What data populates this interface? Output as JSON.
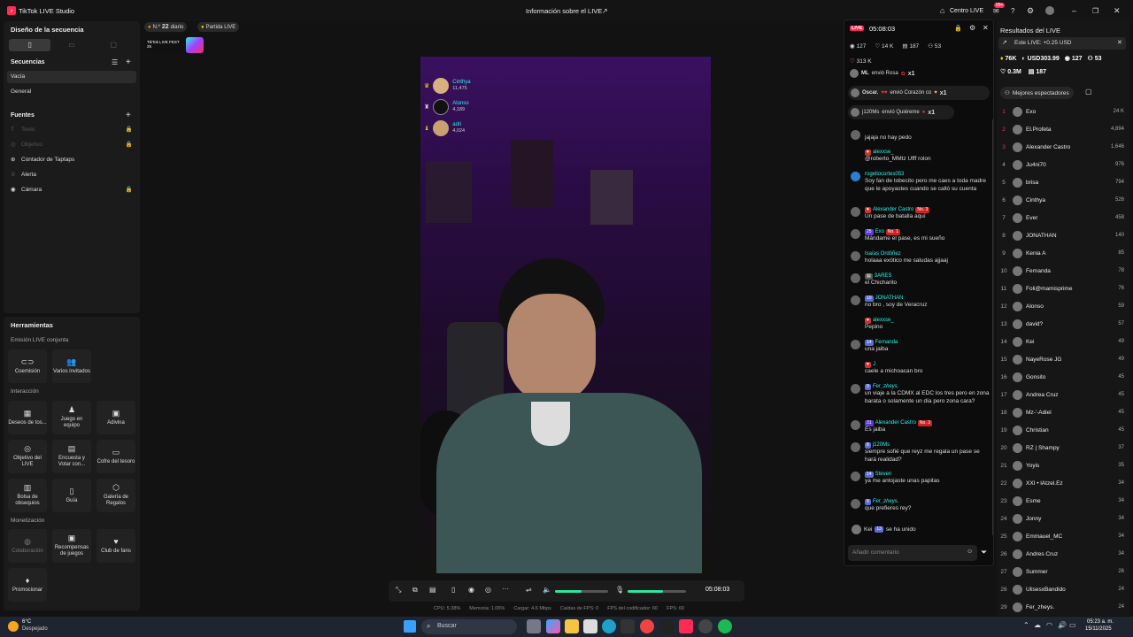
{
  "titlebar": {
    "app_title": "TikTok LIVE Studio",
    "center_title": "Información sobre el LIVE",
    "live_center": "Centro LIVE",
    "notif_badge": "99+"
  },
  "left": {
    "scene_design": "Diseño de la secuencia",
    "sequences": "Secuencias",
    "seq_items": [
      "Vacía",
      "General"
    ],
    "sources": "Fuentes",
    "source_items": [
      "Texto",
      "Objetivo",
      "Contador de Taptaps",
      "Alerta",
      "Cámara"
    ],
    "tools": "Herramientas",
    "joint": "Emisión LIVE conjunta",
    "t_coem": "Coemisión",
    "t_varios": "Varios invitados",
    "interaction": "Interacción",
    "t_deseos": "Deseos de tos...",
    "t_juego": "Juego en equipo",
    "t_adivina": "Adivina",
    "t_objetivo": "Objetivo del LIVE",
    "t_encuesta": "Encuesta y Votar con...",
    "t_cofre": "Cofre del tesoro",
    "t_bolsa": "Bolsa de obsequios",
    "t_guia": "Guía",
    "t_galeria": "Galería de Regalos",
    "monet": "Monetización",
    "t_colab": "Colaboración",
    "t_recomp": "Recompensas de juegos",
    "t_club": "Club de fans",
    "t_promo": "Promocionar"
  },
  "preview": {
    "rank_no": "N.º",
    "rank_val": "22",
    "rank_label": "diario",
    "match": "Partida LIVE",
    "fest": "TikTok LIVE FEST 25",
    "top": [
      {
        "name": "Cinthya",
        "score": "11,475"
      },
      {
        "name": "Alonso",
        "score": "4,189"
      },
      {
        "name": "adri",
        "score": "4,024"
      }
    ]
  },
  "controls": {
    "timer": "05:08:03",
    "mic_level": 0.6,
    "vol_level": 0.5
  },
  "stats": {
    "cpu": "CPU: 5.38%",
    "mem": "Memoria: 1.06%",
    "load": "Cargar: 4.6 Mbps",
    "fps_drop": "Caídas de FPS: 0",
    "enc_fps": "FPS del codificador: 60",
    "fps": "FPS: 60"
  },
  "chat": {
    "live": "LIVE",
    "timer": "05:08:03",
    "viewers": "127",
    "likes": "14 K",
    "shares": "187",
    "users": "53",
    "diamonds": "313 K",
    "gifts": [
      {
        "user": "ML",
        "text": "envió Rosa",
        "count": "x1"
      },
      {
        "user": "Oscar.",
        "text": "envió Corazón co",
        "count": "x1"
      },
      {
        "user": "j120Ms",
        "text": "envió Quiéreme",
        "count": "x1"
      }
    ],
    "messages": [
      {
        "user": "",
        "badge": "",
        "text": "jajaja no hay pedo"
      },
      {
        "user": "alexxse_",
        "badge": "",
        "text": "@roberto_MMtz Ufff rolon"
      },
      {
        "user": "rogeliocortes053",
        "badge": "",
        "text": "Soy fan de tobecito pero me caes a toda madre que le apoyastes cuando se calló su cuenta"
      },
      {
        "user": "Alexander Castro",
        "badge": "No. 3",
        "text": "Un pase de batalla aquí"
      },
      {
        "user": "Exo",
        "badge": "No. 1",
        "text": "Mándame el pase, es mi sueño"
      },
      {
        "user": "Isaías Ordóñez",
        "badge": "",
        "text": "holaaa exótico me saludas ajjaaj"
      },
      {
        "user": "3ARES",
        "badge": "",
        "text": "el Chicharito"
      },
      {
        "user": "JONATHAN",
        "badge": "",
        "text": "no bro , soy de Veracruz"
      },
      {
        "user": "alexxse_",
        "badge": "",
        "text": "Pepino"
      },
      {
        "user": "Fernanda",
        "badge": "",
        "text": "una jaiba"
      },
      {
        "user": "J",
        "badge": "",
        "text": "caele a michoacan bro"
      },
      {
        "user": "Fer_zheys.",
        "badge": "",
        "text": "un viaje a la CDMX al EDC los tres pero en zona barata o solamente un día pero zona cara?"
      },
      {
        "user": "Alexander Castro",
        "badge": "No. 3",
        "text": "Es jaiba"
      },
      {
        "user": "j120Ms",
        "badge": "",
        "text": "siempre sofié que reyz me regala un pase se hará realidad?"
      },
      {
        "user": "Steven",
        "badge": "",
        "text": "ya me antojaste unas papitas"
      },
      {
        "user": "Fer_zheys.",
        "badge": "",
        "text": "que prefieres rey?"
      }
    ],
    "joined_user": "Kei",
    "joined_text": "se ha unido",
    "comment_placeholder": "Añadir comentario"
  },
  "results": {
    "title": "Resultados del LIVE",
    "this_live": "Este LIVE: +0.25 USD",
    "s1": "76K",
    "s2": "USD303.99",
    "s3": "127",
    "s4": "53",
    "s5": "0.3M",
    "s6": "187",
    "best": "Mejores espectadores",
    "ranking": [
      [
        "1",
        "Exo",
        "24 K"
      ],
      [
        "2",
        "El.Profeta",
        "4,894"
      ],
      [
        "3",
        "Alexander Castro",
        "1,646"
      ],
      [
        "4",
        "Ju4ni70",
        "976"
      ],
      [
        "5",
        "brisa",
        "794"
      ],
      [
        "6",
        "Cinthya",
        "526"
      ],
      [
        "7",
        "Ever",
        "458"
      ],
      [
        "8",
        "JONATHAN",
        "140"
      ],
      [
        "9",
        "Kenia A",
        "85"
      ],
      [
        "10",
        "Fernanda",
        "78"
      ],
      [
        "11",
        "Foli@mamisprime",
        "76"
      ],
      [
        "12",
        "Alonso",
        "59"
      ],
      [
        "13",
        "david?",
        "57"
      ],
      [
        "14",
        "Kei",
        "49"
      ],
      [
        "15",
        "NayeRose JG",
        "49"
      ],
      [
        "16",
        "Gonsito",
        "45"
      ],
      [
        "17",
        "Andrea Cruz",
        "45"
      ],
      [
        "18",
        "Mz-'-Adiel",
        "45"
      ],
      [
        "19",
        "Christian",
        "45"
      ],
      [
        "20",
        "RZ | Shampy",
        "37"
      ],
      [
        "21",
        "Yoyis",
        "35"
      ],
      [
        "22",
        "XXI • lAtzel.Ez",
        "34"
      ],
      [
        "23",
        "Esme",
        "34"
      ],
      [
        "24",
        "Jonny",
        "34"
      ],
      [
        "25",
        "Emmauel_MC",
        "34"
      ],
      [
        "26",
        "Andres Cruz",
        "34"
      ],
      [
        "27",
        "Summer",
        "26"
      ],
      [
        "28",
        "UlisesxBandido",
        "24"
      ],
      [
        "29",
        "Fer_zheys.",
        "24"
      ]
    ]
  },
  "taskbar": {
    "temp": "6°C",
    "weather": "Despejado",
    "search": "Buscar",
    "time": "05:23 a. m.",
    "date": "15/11/2025"
  },
  "colors": {
    "accent": "#fe2c55",
    "cyan": "#25f4ee",
    "bg": "#121212"
  }
}
